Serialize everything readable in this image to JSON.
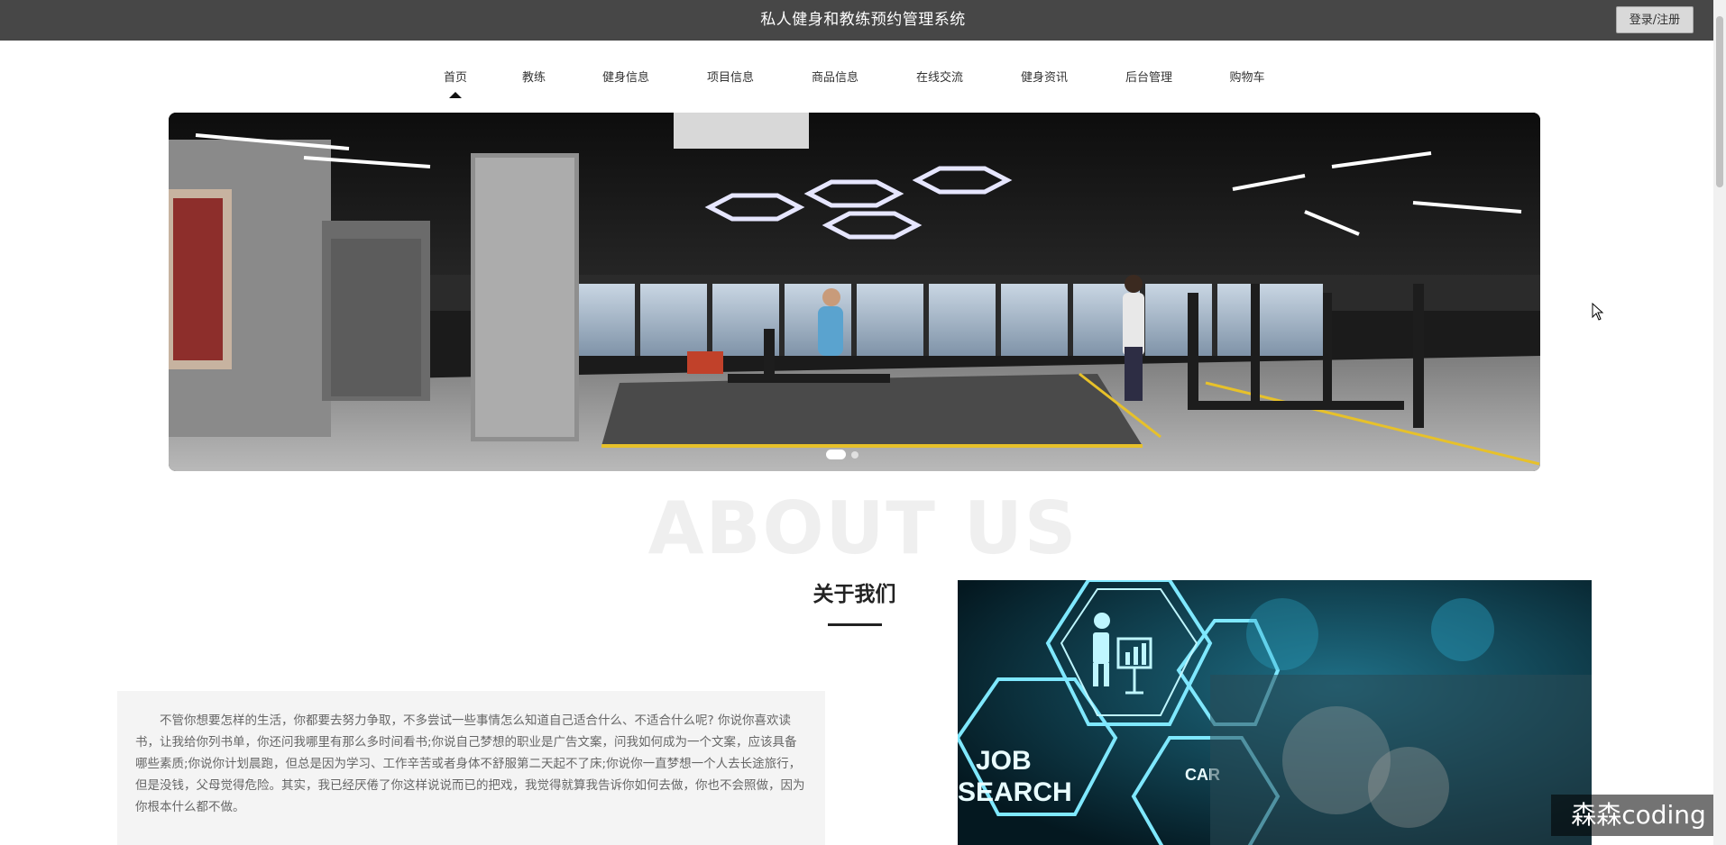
{
  "header": {
    "title": "私人健身和教练预约管理系统",
    "login_label": "登录/注册"
  },
  "nav": {
    "items": [
      {
        "label": "首页",
        "active": true
      },
      {
        "label": "教练"
      },
      {
        "label": "健身信息"
      },
      {
        "label": "项目信息"
      },
      {
        "label": "商品信息"
      },
      {
        "label": "在线交流"
      },
      {
        "label": "健身资讯"
      },
      {
        "label": "后台管理"
      },
      {
        "label": "购物车"
      }
    ]
  },
  "banner": {
    "image": "gym-interior"
  },
  "about": {
    "bg_text": "ABOUT US",
    "title": "关于我们",
    "text": "不管你想要怎样的生活，你都要去努力争取，不多尝试一些事情怎么知道自己适合什么、不适合什么呢? 你说你喜欢读书，让我给你列书单，你还问我哪里有那么多时间看书;你说自己梦想的职业是广告文案，问我如何成为一个文案，应该具备哪些素质;你说你计划晨跑，但总是因为学习、工作辛苦或者身体不舒服第二天起不了床;你说你一直梦想一个人去长途旅行，但是没钱，父母觉得危险。其实，我已经厌倦了你这样说说而已的把戏，我觉得就算我告诉你如何去做，你也不会照做，因为你根本什么都不做。",
    "image_text_1": "JOB",
    "image_text_2": "SEARCH",
    "image_text_3": "CAR"
  },
  "watermark": "森森coding"
}
